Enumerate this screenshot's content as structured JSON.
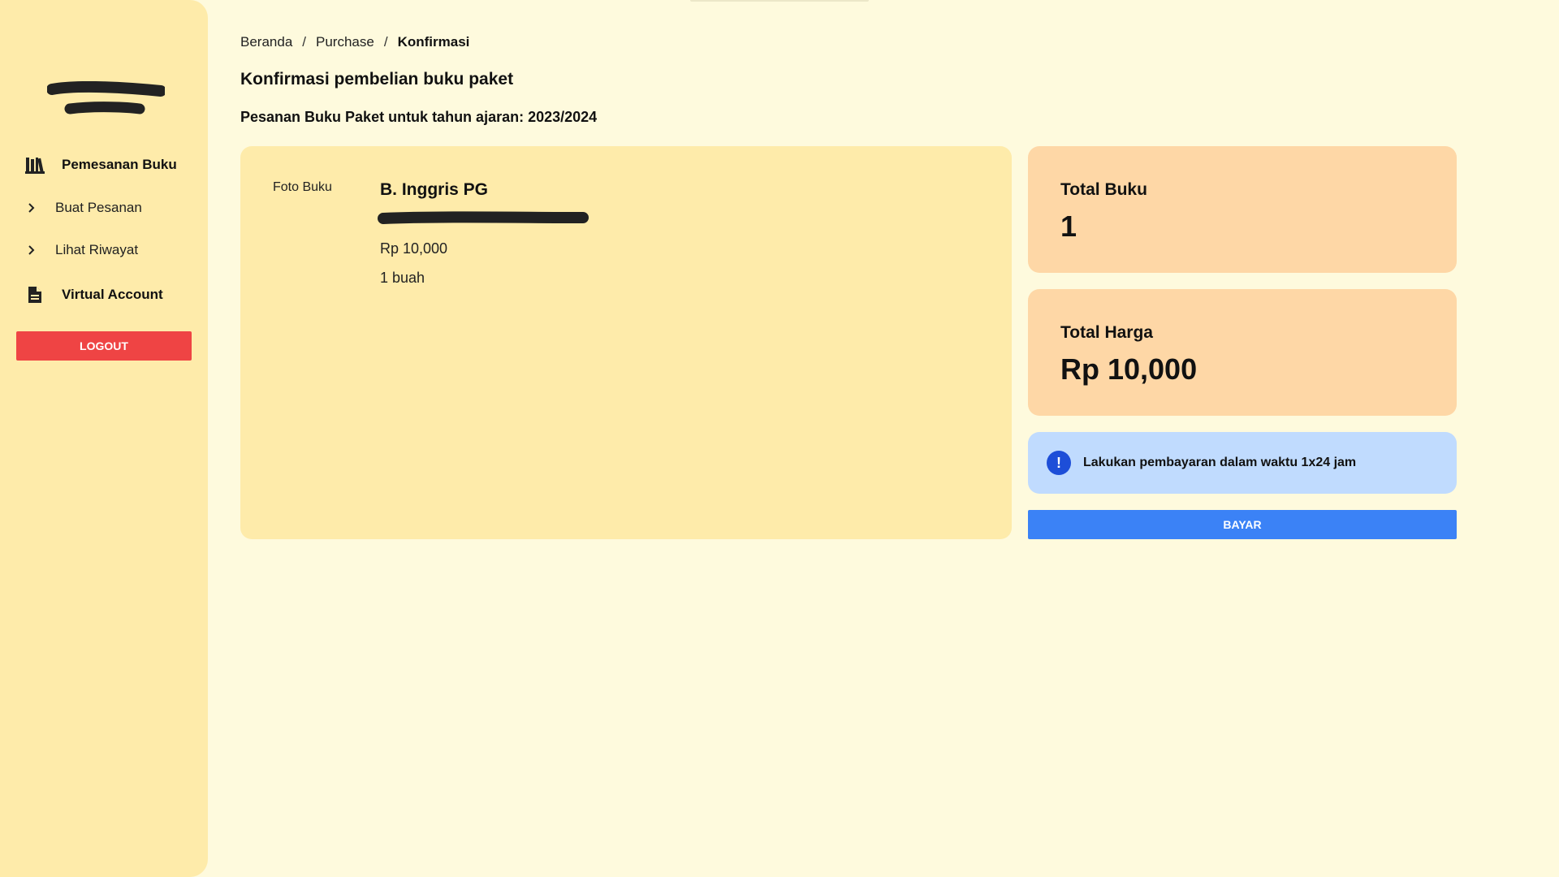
{
  "sidebar": {
    "nav": [
      {
        "label": "Pemesanan Buku",
        "icon": "books-icon"
      },
      {
        "label": "Virtual Account",
        "icon": "document-icon"
      }
    ],
    "sub_items": [
      {
        "label": "Buat Pesanan",
        "icon": "chevron-right-icon"
      },
      {
        "label": "Lihat Riwayat",
        "icon": "chevron-right-icon"
      }
    ],
    "logout_label": "Logout"
  },
  "breadcrumb": {
    "items": [
      "Beranda",
      "Purchase",
      "Konfirmasi"
    ],
    "separator": "/"
  },
  "main": {
    "title": "Konfirmasi pembelian buku paket",
    "subtitle": "Pesanan Buku Paket untuk tahun ajaran: 2023/2024"
  },
  "book": {
    "photo_label": "Foto Buku",
    "title": "B. Inggris PG",
    "price": "Rp 10,000",
    "quantity": "1 buah"
  },
  "summary": {
    "total_books_label": "Total Buku",
    "total_books_value": "1",
    "total_price_label": "Total Harga",
    "total_price_value": "Rp 10,000"
  },
  "alert": {
    "icon": "!",
    "message": "Lakukan pembayaran dalam waktu 1x24 jam"
  },
  "pay_button_label": "Bayar",
  "colors": {
    "background": "#fefadd",
    "sidebar": "#feebaa",
    "card": "#feebaa",
    "stat_card": "#fed7a6",
    "alert_bg": "#c0dbfe",
    "logout": "#ef4444",
    "pay": "#3b82f6"
  }
}
